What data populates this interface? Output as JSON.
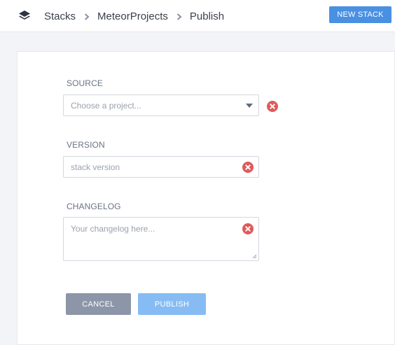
{
  "header": {
    "logo_icon": "stack-layers-icon",
    "breadcrumb": [
      {
        "label": "Stacks"
      },
      {
        "label": "MeteorProjects"
      },
      {
        "label": "Publish"
      }
    ],
    "separator_icon": "chevron-right-icon",
    "new_stack_label": "NEW STACK"
  },
  "form": {
    "source": {
      "label": "SOURCE",
      "placeholder": "Choose a project...",
      "dropdown_icon": "caret-down-icon",
      "error_icon": "error-close-icon"
    },
    "version": {
      "label": "VERSION",
      "placeholder": "stack version",
      "error_icon": "error-close-icon"
    },
    "changelog": {
      "label": "CHANGELOG",
      "placeholder": "Your changelog here...",
      "error_icon": "error-close-icon",
      "resize_icon": "resize-grip-icon"
    },
    "cancel_label": "CANCEL",
    "publish_label": "PUBLISH"
  },
  "colors": {
    "primary": "#4a90e2",
    "primary_disabled": "#86bcf3",
    "secondary": "#8c96a8",
    "error": "#e05a5a",
    "background": "#f3f4f7"
  }
}
